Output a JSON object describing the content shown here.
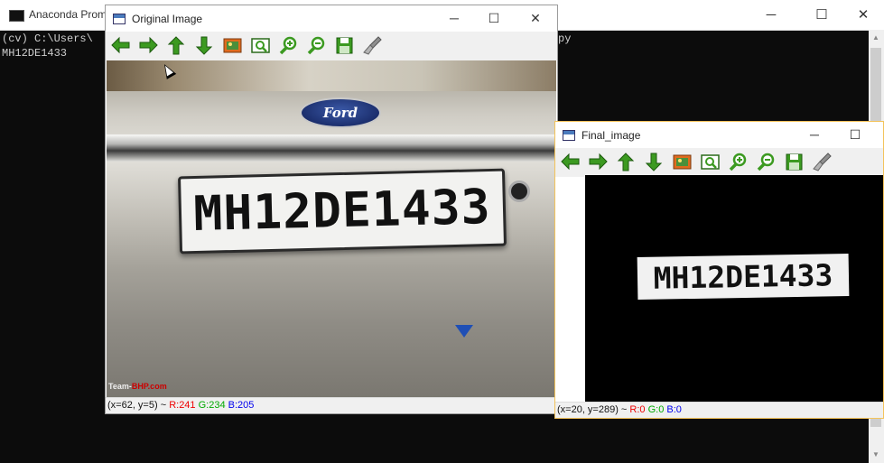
{
  "console": {
    "title": "Anaconda Prompt",
    "line1": "(cv) C:\\Users\\",
    "line1_tail": "py",
    "line2": "MH12DE1433",
    "controls": {
      "minimize": "─",
      "maximize": "☐",
      "close": "✕"
    }
  },
  "original_window": {
    "title": "Original Image",
    "controls": {
      "minimize": "─",
      "maximize": "☐",
      "close": "✕"
    },
    "toolbar": [
      {
        "name": "pan-left-icon",
        "glyph": "arrow-left"
      },
      {
        "name": "pan-right-icon",
        "glyph": "arrow-right"
      },
      {
        "name": "pan-up-icon",
        "glyph": "arrow-up"
      },
      {
        "name": "pan-down-icon",
        "glyph": "arrow-down"
      },
      {
        "name": "zoom-image-icon",
        "glyph": "image"
      },
      {
        "name": "zoom-fit-icon",
        "glyph": "zoom-fit"
      },
      {
        "name": "zoom-in-icon",
        "glyph": "zoom-in"
      },
      {
        "name": "zoom-out-icon",
        "glyph": "zoom-out"
      },
      {
        "name": "save-icon",
        "glyph": "save"
      },
      {
        "name": "properties-icon",
        "glyph": "brush"
      }
    ],
    "image": {
      "plate_text": "MH12DE1433",
      "badge_text": "Ford",
      "watermark_team": "Team-",
      "watermark_bhp": "BHP.com"
    },
    "status": {
      "coords": "(x=62, y=5) ~ ",
      "r": "R:241",
      "g": "G:234",
      "b": "B:205"
    }
  },
  "final_window": {
    "title": "Final_image",
    "controls": {
      "minimize": "─",
      "maximize": "☐"
    },
    "plate_text": "MH12DE1433",
    "status": {
      "coords": "(x=20, y=289) ~ ",
      "r": "R:0",
      "g": "G:0",
      "b": "B:0"
    }
  },
  "colors": {
    "toolbar_green": "#3c9a21",
    "accent_border": "#f3c35a"
  }
}
